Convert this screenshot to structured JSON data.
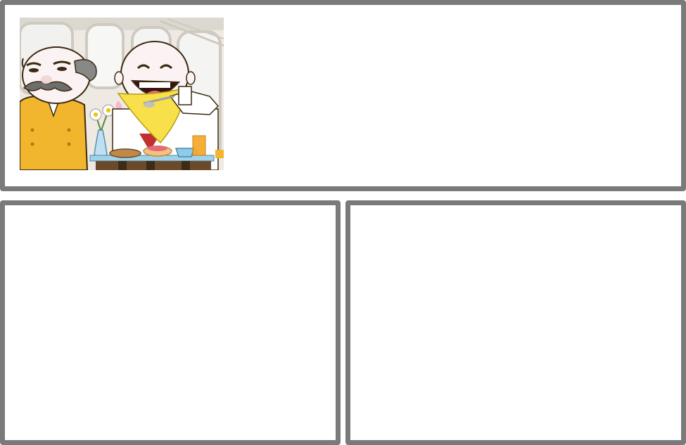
{
  "panels": [
    {
      "id": "top",
      "content": "cartoon"
    },
    {
      "id": "bottom-left",
      "content": ""
    },
    {
      "id": "bottom-right",
      "content": ""
    }
  ],
  "illustration": {
    "subject": "breakfast-in-dining-car",
    "colors": {
      "frame": "#7a7a7a",
      "vest": "#f2b62e",
      "napkin": "#f7e04a",
      "table": "#6b4a2b",
      "wall": "#eeeae3",
      "juice": "#f4a623",
      "cup": "#8ecbea"
    }
  }
}
